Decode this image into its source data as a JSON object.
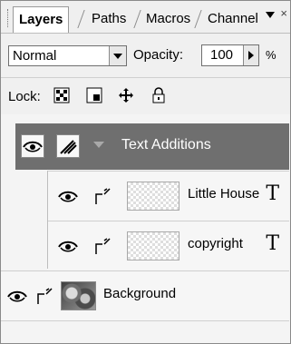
{
  "tabs": [
    {
      "label": "Layers",
      "active": true
    },
    {
      "label": "Paths",
      "active": false
    },
    {
      "label": "Macros",
      "active": false
    },
    {
      "label": "Channel",
      "active": false
    }
  ],
  "blend_mode": {
    "value": "Normal"
  },
  "opacity": {
    "label": "Opacity:",
    "value": "100",
    "unit": "%"
  },
  "lock": {
    "label": "Lock:",
    "icons": [
      "checker-lock-icon",
      "pixel-lock-icon",
      "move-lock-icon",
      "padlock-icon"
    ]
  },
  "layers": {
    "group": {
      "name": "Text Additions"
    },
    "items": [
      {
        "name": "Little House",
        "type_icon": "T"
      },
      {
        "name": "copyright",
        "type_icon": "T"
      }
    ],
    "background": {
      "name": "Background"
    }
  },
  "colors": {
    "group_bg": "#6f6f6f",
    "panel_bg": "#f0f0f0"
  }
}
